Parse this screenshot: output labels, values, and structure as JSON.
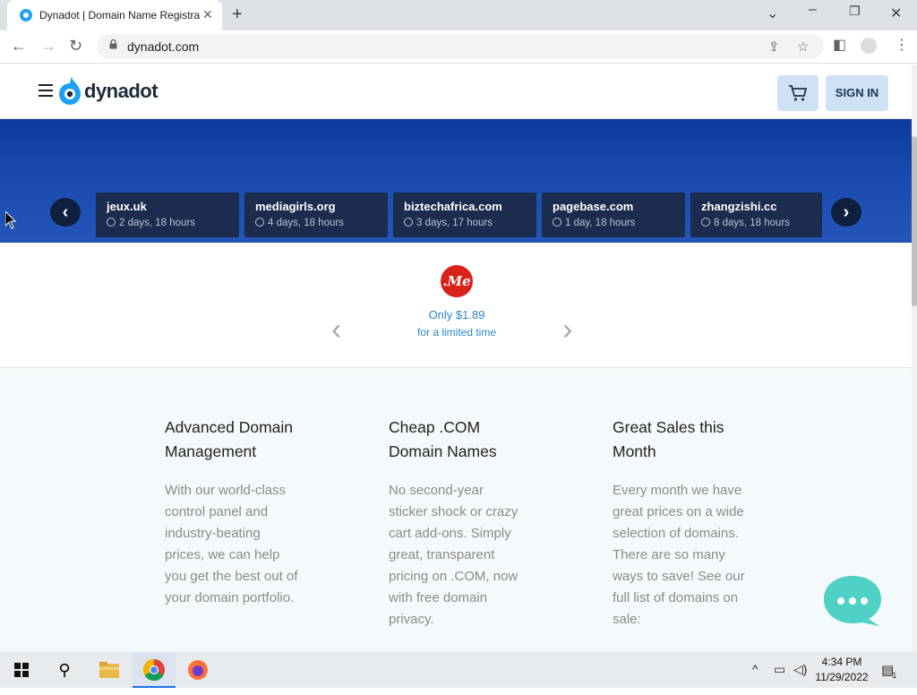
{
  "browser": {
    "tab_title": "Dynadot | Domain Name Registrar",
    "url": "dynadot.com"
  },
  "header": {
    "logo_text": "dynadot",
    "signin_label": "SIGN IN"
  },
  "banner": {
    "domains": [
      {
        "name": "jeux.uk",
        "time": "2 days, 18 hours"
      },
      {
        "name": "mediagirls.org",
        "time": "4 days, 18 hours"
      },
      {
        "name": "biztechafrica.com",
        "time": "3 days, 17 hours"
      },
      {
        "name": "pagebase.com",
        "time": "1 day, 18 hours"
      },
      {
        "name": "zhangzishi.cc",
        "time": "8 days, 18 hours"
      }
    ]
  },
  "promo": {
    "badge": ".Me",
    "price": "Only $1.89",
    "subtitle": "for a limited time"
  },
  "features": [
    {
      "title": "Advanced Domain Management",
      "body": "With our world-class control panel and industry-beating prices, we can help you get the best out of your domain portfolio."
    },
    {
      "title": "Cheap .COM Domain Names",
      "body": "No second-year sticker shock or crazy cart add-ons. Simply great, transparent pricing on .COM, now with free domain privacy."
    },
    {
      "title": "Great Sales this Month",
      "body": "Every month we have great prices on a wide selection of domains. There are so many ways to save! See our full list of domains on sale:"
    }
  ],
  "taskbar": {
    "time": "4:34 PM",
    "date": "11/29/2022",
    "notification_count": "1"
  },
  "colors": {
    "brand_blue": "#1da1f2",
    "banner_blue": "#1a4bb0",
    "card_dark": "#1c2c4e",
    "accent_link": "#2b86c5",
    "chat_teal": "#4fd1c5"
  }
}
